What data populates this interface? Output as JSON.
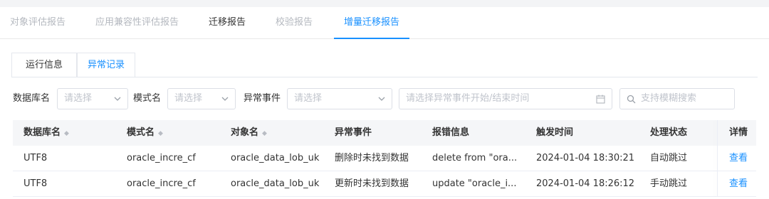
{
  "tabs": [
    {
      "label": "对象评估报告"
    },
    {
      "label": "应用兼容性评估报告"
    },
    {
      "label": "迁移报告"
    },
    {
      "label": "校验报告"
    },
    {
      "label": "增量迁移报告"
    }
  ],
  "subtabs": [
    {
      "label": "运行信息"
    },
    {
      "label": "异常记录"
    }
  ],
  "filters": {
    "db_label": "数据库名",
    "db_placeholder": "请选择",
    "schema_label": "模式名",
    "schema_placeholder": "请选择",
    "event_label": "异常事件",
    "event_placeholder": "请选择",
    "time_placeholder": "请选择异常事件开始/结束时间",
    "search_placeholder": "支持模糊搜索"
  },
  "table": {
    "headers": [
      "数据库名",
      "模式名",
      "对象名",
      "异常事件",
      "报错信息",
      "触发时间",
      "处理状态",
      "详情"
    ],
    "rows": [
      [
        "UTF8",
        "oracle_incre_cf",
        "oracle_data_lob_uk",
        "删除时未找到数据",
        "delete from \"ora...",
        "2024-01-04 18:30:21",
        "自动跳过",
        "查看"
      ],
      [
        "UTF8",
        "oracle_incre_cf",
        "oracle_data_lob_uk",
        "更新时未找到数据",
        "update \"oracle_i...",
        "2024-01-04 18:26:12",
        "手动跳过",
        "查看"
      ]
    ]
  },
  "colors": {
    "accent": "#1890ff",
    "header_bg": "#f5f6f8",
    "muted_text": "#b4b8bf"
  }
}
